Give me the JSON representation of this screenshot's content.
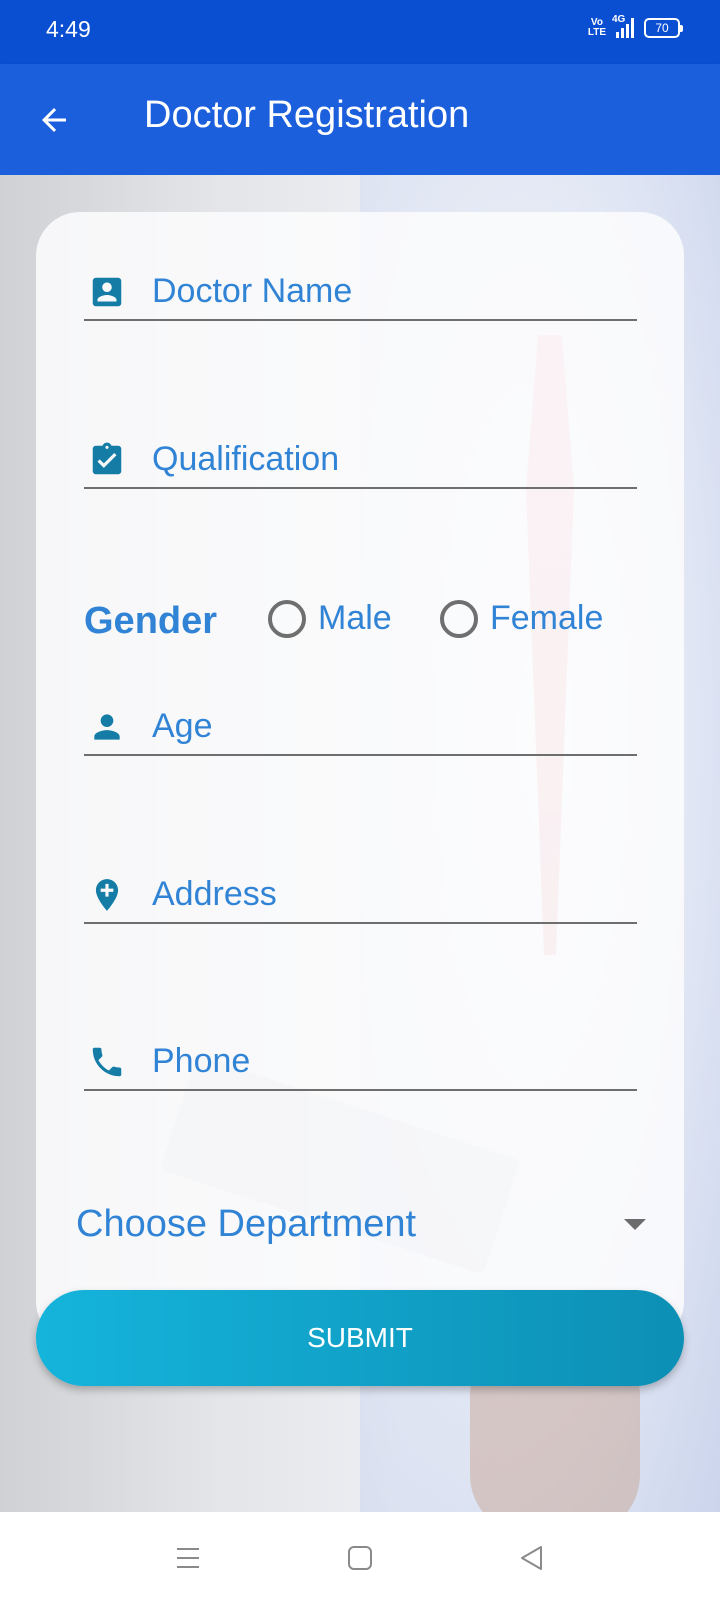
{
  "status_bar": {
    "time": "4:49",
    "volte_top": "Vo",
    "volte_bottom": "LTE",
    "network": "4G",
    "battery": "70"
  },
  "app_bar": {
    "title": "Doctor Registration",
    "back_icon": "arrow-left-icon"
  },
  "form": {
    "doctor_name": {
      "placeholder": "Doctor Name",
      "icon": "account-box-icon"
    },
    "qualification": {
      "placeholder": "Qualification",
      "icon": "assignment-turned-in-icon"
    },
    "gender": {
      "label": "Gender",
      "options": [
        "Male",
        "Female"
      ]
    },
    "age": {
      "placeholder": "Age",
      "icon": "person-icon"
    },
    "address": {
      "placeholder": "Address",
      "icon": "add-location-icon"
    },
    "phone": {
      "placeholder": "Phone",
      "icon": "phone-icon"
    },
    "department": {
      "placeholder": "Choose Department"
    },
    "submit_label": "SUBMIT"
  },
  "colors": {
    "status_bar": "#0a4fd1",
    "app_bar": "#1c5fdc",
    "field_text": "#3184d5",
    "icon": "#157ca6",
    "submit_start": "#15b4db",
    "submit_end": "#0d8fb5"
  },
  "nav_bar": {
    "icons": [
      "menu-icon",
      "home-square-icon",
      "back-triangle-icon"
    ]
  }
}
